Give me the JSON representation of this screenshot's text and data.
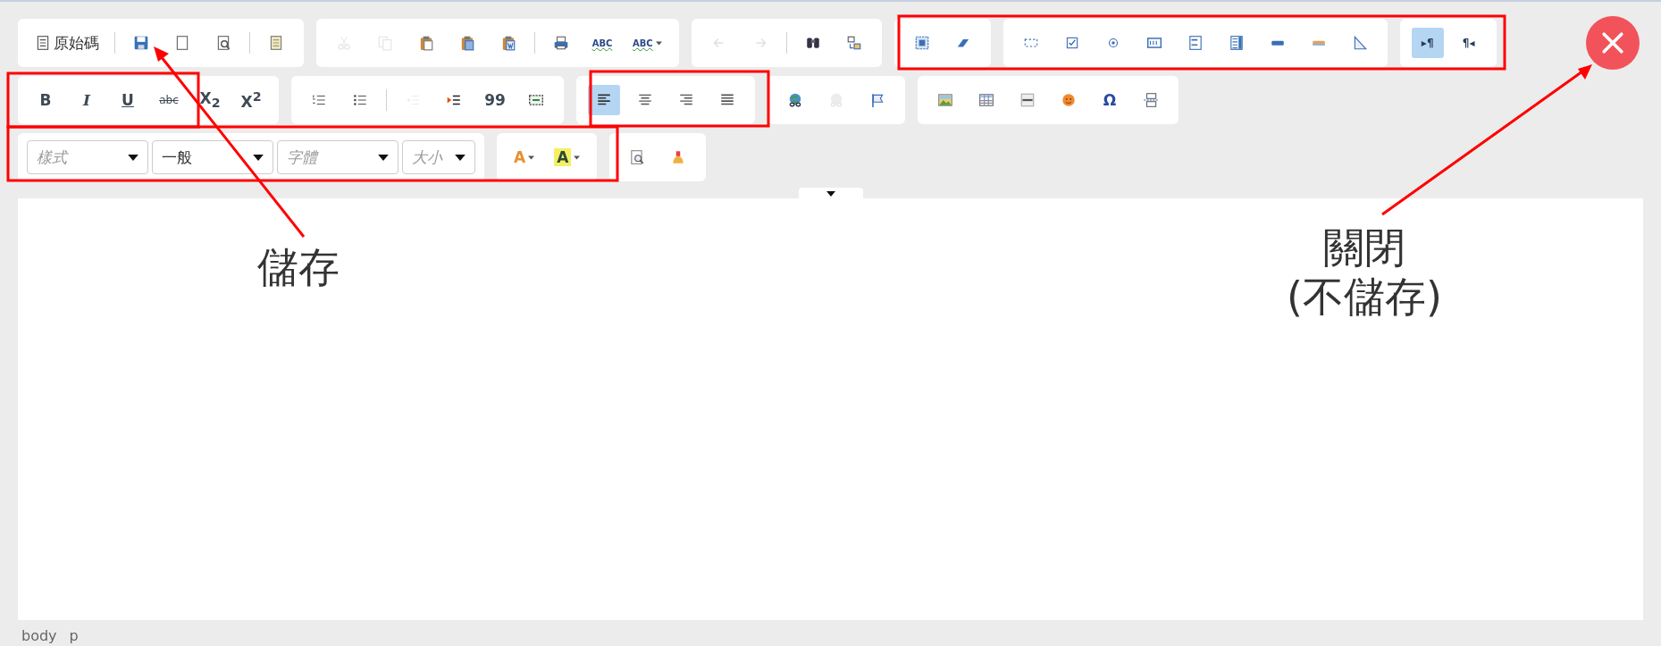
{
  "toolbar": {
    "rows": [
      {
        "groups": [
          {
            "sections": [
              [
                {
                  "kind": "source",
                  "label": "原始碼",
                  "disabled": false
                }
              ],
              [
                {
                  "kind": "save",
                  "disabled": false
                },
                {
                  "kind": "newpage",
                  "disabled": false
                },
                {
                  "kind": "preview",
                  "disabled": false
                }
              ],
              [
                {
                  "kind": "templates",
                  "disabled": false
                }
              ]
            ]
          },
          {
            "sections": [
              [
                {
                  "kind": "cut",
                  "disabled": true
                },
                {
                  "kind": "copy",
                  "disabled": true
                },
                {
                  "kind": "paste",
                  "disabled": false
                },
                {
                  "kind": "pastetext",
                  "disabled": false
                },
                {
                  "kind": "pasteword",
                  "disabled": false
                }
              ],
              [
                {
                  "kind": "print",
                  "disabled": false
                },
                {
                  "kind": "spell",
                  "glyph": "ABC",
                  "disabled": false
                },
                {
                  "kind": "scayt",
                  "glyph": "ABC",
                  "disabled": false
                }
              ]
            ]
          },
          {
            "sections": [
              [
                {
                  "kind": "undo",
                  "disabled": true
                },
                {
                  "kind": "redo",
                  "disabled": true
                }
              ],
              [
                {
                  "kind": "find",
                  "disabled": false
                },
                {
                  "kind": "replace",
                  "disabled": false
                }
              ]
            ]
          },
          {
            "sections": [
              [
                {
                  "kind": "selectall",
                  "disabled": false
                },
                {
                  "kind": "eraser",
                  "disabled": false
                }
              ]
            ]
          },
          {
            "sections": [
              [
                {
                  "kind": "form",
                  "disabled": false
                },
                {
                  "kind": "checkbox",
                  "disabled": false
                },
                {
                  "kind": "radio",
                  "disabled": false
                },
                {
                  "kind": "textfield",
                  "disabled": false
                },
                {
                  "kind": "textarea",
                  "disabled": false
                },
                {
                  "kind": "select",
                  "disabled": false
                },
                {
                  "kind": "button",
                  "disabled": false
                },
                {
                  "kind": "imagebutton",
                  "disabled": false
                },
                {
                  "kind": "hidden",
                  "disabled": false
                }
              ]
            ]
          },
          {
            "sections": [
              [
                {
                  "kind": "ltr",
                  "glyph": "▸¶",
                  "selected": true,
                  "disabled": false
                },
                {
                  "kind": "rtl",
                  "glyph": "¶◂",
                  "selected": false,
                  "disabled": false
                }
              ]
            ]
          }
        ]
      },
      {
        "groups": [
          {
            "sections": [
              [
                {
                  "kind": "bold",
                  "glyph": "B",
                  "disabled": false
                },
                {
                  "kind": "italic",
                  "glyph": "I",
                  "disabled": false
                },
                {
                  "kind": "underline",
                  "glyph": "U",
                  "disabled": false
                },
                {
                  "kind": "strike",
                  "glyph": "abc",
                  "disabled": false
                },
                {
                  "kind": "sub",
                  "glyph": "X$_{2}$",
                  "disabled": false
                },
                {
                  "kind": "sup",
                  "glyph": "X$^{2}$",
                  "disabled": false
                }
              ]
            ]
          },
          {
            "sections": [
              [
                {
                  "kind": "ol",
                  "disabled": false
                },
                {
                  "kind": "ul",
                  "disabled": false
                }
              ],
              [
                {
                  "kind": "outdent",
                  "disabled": true
                },
                {
                  "kind": "indent",
                  "disabled": false
                },
                {
                  "kind": "blockquote",
                  "glyph": "99",
                  "disabled": false
                },
                {
                  "kind": "div",
                  "disabled": false
                }
              ]
            ]
          },
          {
            "sections": [
              [
                {
                  "kind": "alignleft",
                  "selected": true,
                  "disabled": false
                },
                {
                  "kind": "aligncenter",
                  "selected": false,
                  "disabled": false
                },
                {
                  "kind": "alignright",
                  "selected": false,
                  "disabled": false
                },
                {
                  "kind": "justify",
                  "selected": false,
                  "disabled": false
                }
              ]
            ]
          },
          {
            "sections": [
              [
                {
                  "kind": "link",
                  "disabled": false
                },
                {
                  "kind": "unlink",
                  "disabled": true
                },
                {
                  "kind": "anchor",
                  "disabled": false
                }
              ]
            ]
          },
          {
            "sections": [
              [
                {
                  "kind": "image",
                  "disabled": false
                },
                {
                  "kind": "table",
                  "disabled": false
                },
                {
                  "kind": "hr",
                  "disabled": false
                },
                {
                  "kind": "smiley",
                  "disabled": false
                },
                {
                  "kind": "specialchar",
                  "glyph": "Ω",
                  "disabled": false
                },
                {
                  "kind": "pagebreak",
                  "disabled": false
                }
              ]
            ]
          }
        ]
      },
      {
        "groups": [
          {
            "sections": [
              [
                {
                  "kind": "combo",
                  "placeholder": "樣式"
                },
                {
                  "kind": "combo",
                  "value": "一般"
                },
                {
                  "kind": "combo",
                  "placeholder": "字體"
                },
                {
                  "kind": "combo",
                  "placeholder": "大小"
                }
              ]
            ]
          },
          {
            "sections": [
              [
                {
                  "kind": "textcolor",
                  "glyph": "A",
                  "disabled": false
                },
                {
                  "kind": "bgcolor",
                  "glyph": "A",
                  "disabled": false
                }
              ]
            ]
          },
          {
            "sections": [
              [
                {
                  "kind": "findpage",
                  "disabled": false
                },
                {
                  "kind": "brush",
                  "disabled": false
                }
              ]
            ]
          }
        ]
      }
    ]
  },
  "status_bar": {
    "path": [
      "body",
      "p"
    ]
  },
  "annotations": [
    {
      "kind": "save",
      "lines": [
        "儲存"
      ]
    },
    {
      "kind": "close",
      "lines": [
        "關閉",
        "(不儲存)"
      ]
    }
  ]
}
